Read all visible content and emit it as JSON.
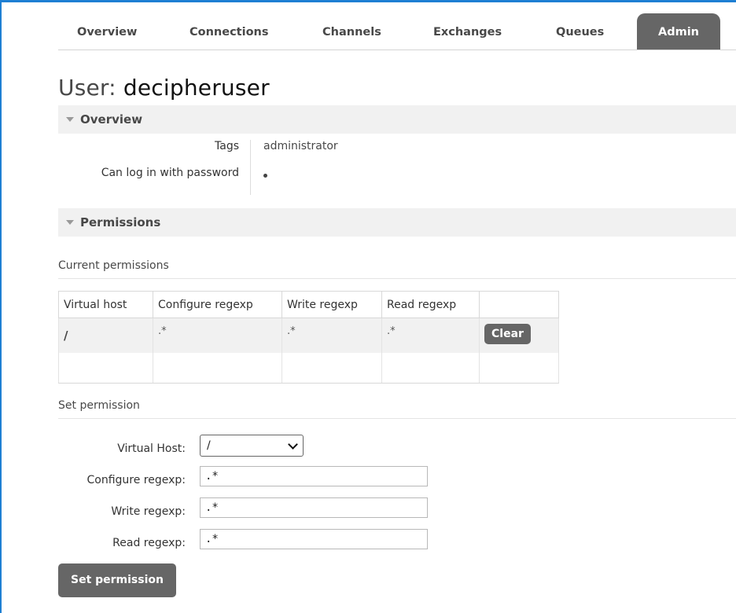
{
  "nav": {
    "tabs": [
      "Overview",
      "Connections",
      "Channels",
      "Exchanges",
      "Queues",
      "Admin"
    ],
    "active": "Admin"
  },
  "page": {
    "title_label": "User:",
    "title_value": "decipheruser"
  },
  "overview": {
    "section_label": "Overview",
    "tags_label": "Tags",
    "tags_value": "administrator",
    "login_label": "Can log in with password",
    "login_value": "•"
  },
  "permissions": {
    "section_label": "Permissions",
    "current_label": "Current permissions",
    "table": {
      "headers": [
        "Virtual host",
        "Configure regexp",
        "Write regexp",
        "Read regexp"
      ],
      "rows": [
        {
          "vhost": "/",
          "configure": ".*",
          "write": ".*",
          "read": ".*",
          "action": "Clear"
        }
      ]
    },
    "set_label": "Set permission",
    "form": {
      "vhost_label": "Virtual Host:",
      "vhost_value": "/",
      "configure_label": "Configure regexp:",
      "configure_value": ".*",
      "write_label": "Write regexp:",
      "write_value": ".*",
      "read_label": "Read regexp:",
      "read_value": ".*",
      "submit_label": "Set permission"
    }
  },
  "colors": {
    "accent": "#1e7fd3",
    "button": "#666666",
    "section_bg": "#f1f1f1"
  }
}
